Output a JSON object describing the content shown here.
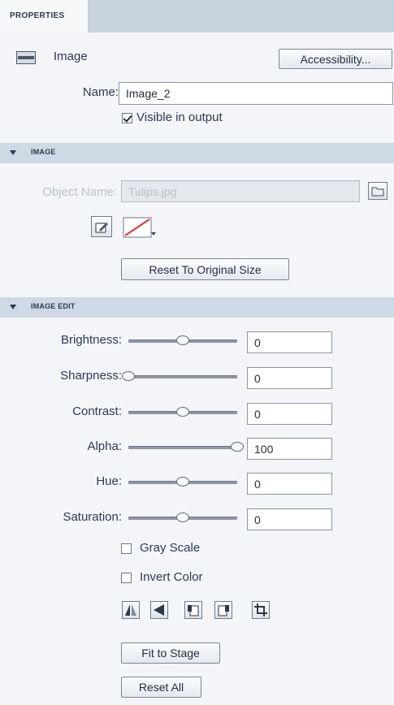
{
  "tab": {
    "label": "PROPERTIES"
  },
  "header": {
    "icon": "image-icon",
    "title": "Image",
    "accessibility_label": "Accessibility..."
  },
  "name_field": {
    "label": "Name:",
    "value": "Image_2"
  },
  "visible_output": {
    "label": "Visible in output",
    "checked": true
  },
  "image_section": {
    "title": "IMAGE",
    "object_label": "Object Name:",
    "object_value": "Tulips.jpg",
    "reset_size_label": "Reset To Original Size"
  },
  "edit_section": {
    "title": "IMAGE EDIT",
    "sliders": [
      {
        "label": "Brightness:",
        "value": "0",
        "level": 0.5
      },
      {
        "label": "Sharpness:",
        "value": "0",
        "level": 0.0
      },
      {
        "label": "Contrast:",
        "value": "0",
        "level": 0.5
      },
      {
        "label": "Alpha:",
        "value": "100",
        "level": 1.0
      },
      {
        "label": "Hue:",
        "value": "0",
        "level": 0.5
      },
      {
        "label": "Saturation:",
        "value": "0",
        "level": 0.5
      }
    ],
    "gray_scale": {
      "label": "Gray Scale",
      "checked": false
    },
    "invert_color": {
      "label": "Invert Color",
      "checked": false
    },
    "tools": [
      "flip-horizontal-icon",
      "flip-vertical-icon",
      "rotate-left-icon",
      "rotate-right-icon",
      "crop-icon"
    ],
    "fit_stage_label": "Fit to Stage",
    "reset_all_label": "Reset All"
  }
}
